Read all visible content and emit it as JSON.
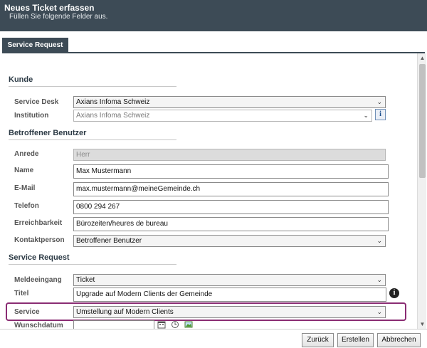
{
  "header": {
    "title": "Neues Ticket erfassen",
    "subtitle": "Füllen Sie folgende Felder aus."
  },
  "tabs": [
    {
      "label": "Service Request",
      "active": true
    }
  ],
  "sections": {
    "kunde": "Kunde",
    "betroffener": "Betroffener Benutzer",
    "service_request": "Service Request"
  },
  "fields": {
    "service_desk": {
      "label": "Service Desk",
      "value": "Axians Infoma Schweiz"
    },
    "institution": {
      "label": "Institution",
      "value": "Axians Infoma Schweiz",
      "info_icon": "info-icon"
    },
    "anrede": {
      "label": "Anrede",
      "value": "Herr"
    },
    "name": {
      "label": "Name",
      "value": "Max Mustermann"
    },
    "email": {
      "label": "E-Mail",
      "value": "max.mustermann@meineGemeinde.ch"
    },
    "telefon": {
      "label": "Telefon",
      "value": "0800 294 267"
    },
    "erreichbarkeit": {
      "label": "Erreichbarkeit",
      "value": "Bürozeiten/heures de bureau"
    },
    "kontaktperson": {
      "label": "Kontaktperson",
      "value": "Betroffener Benutzer"
    },
    "meldeeingang": {
      "label": "Meldeeingang",
      "value": "Ticket"
    },
    "titel": {
      "label": "Titel",
      "value": "Upgrade auf Modern Clients der Gemeinde"
    },
    "service": {
      "label": "Service",
      "value": "Umstellung auf Modern Clients"
    },
    "wunschdatum": {
      "label": "Wunschdatum",
      "value": ""
    }
  },
  "footer": {
    "back": "Zurück",
    "create": "Erstellen",
    "cancel": "Abbrechen"
  },
  "colors": {
    "header_bg": "#3d4b56",
    "highlight": "#8a2c73"
  }
}
